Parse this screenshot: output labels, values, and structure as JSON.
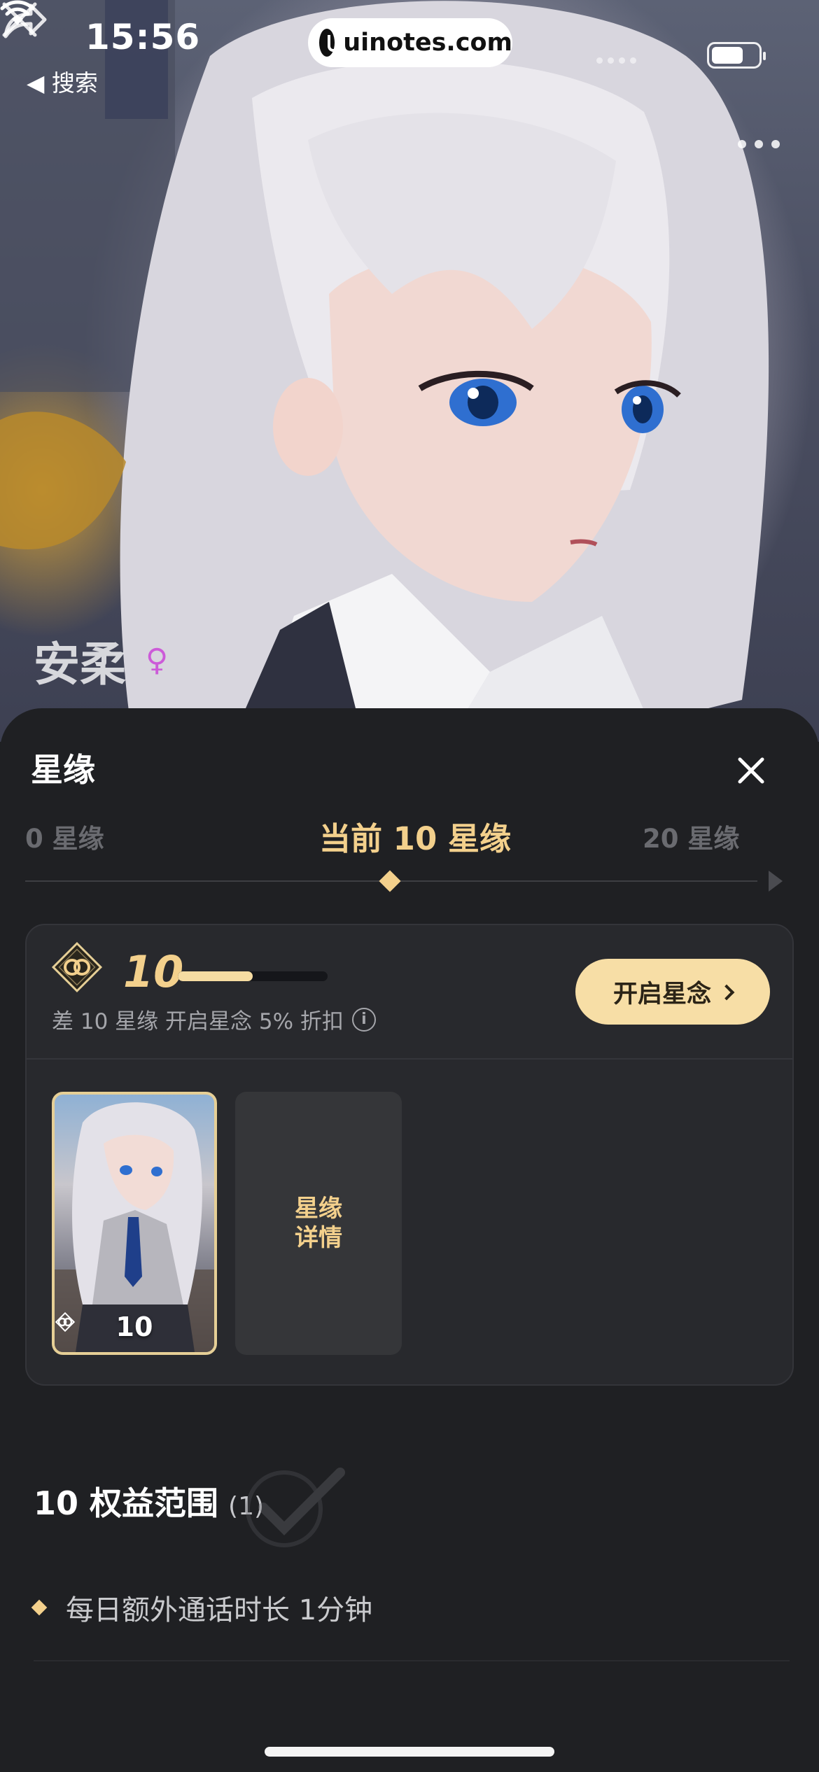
{
  "status_bar": {
    "time": "15:56",
    "back_label": "◀ 搜索",
    "url": "uinotes.com"
  },
  "hero": {
    "character_name": "安柔",
    "gender_symbol": "♀"
  },
  "icons": {
    "close": "close-icon",
    "share": "share-icon",
    "more": "more-icon",
    "wifi": "wifi-icon",
    "battery": "battery-icon",
    "badge": "star-bond-badge-icon",
    "info": "info-icon"
  },
  "sheet": {
    "title": "星缘",
    "tiers": {
      "left": "0 星缘",
      "current": "当前 10 星缘",
      "right": "20 星缘"
    },
    "card": {
      "level": "10",
      "progress_fraction": 0.5,
      "hint": "差 10 星缘 开启星念 5% 折扣",
      "open_button": "开启星念",
      "thumb_label": "10",
      "detail_label": "星缘详情"
    },
    "benefits": {
      "title": "10 权益范围",
      "count": "(1)",
      "items": [
        "每日额外通话时长 1分钟"
      ]
    }
  },
  "colors": {
    "accent_gold": "#f3d08c",
    "button_bg": "#f7dea6",
    "sheet_bg": "#1f2023",
    "card_bg": "#28292d",
    "gender_pink": "#cc5bd8"
  }
}
